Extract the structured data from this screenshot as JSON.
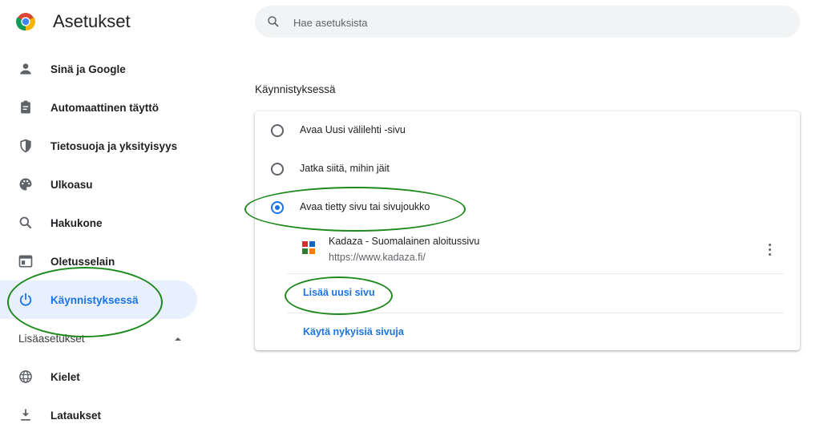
{
  "header": {
    "title": "Asetukset",
    "search_placeholder": "Hae asetuksista"
  },
  "sidebar": {
    "items": [
      {
        "label": "Sinä ja Google",
        "icon": "person-icon"
      },
      {
        "label": "Automaattinen täyttö",
        "icon": "clipboard-icon"
      },
      {
        "label": "Tietosuoja ja yksityisyys",
        "icon": "shield-icon"
      },
      {
        "label": "Ulkoasu",
        "icon": "palette-icon"
      },
      {
        "label": "Hakukone",
        "icon": "search-icon"
      },
      {
        "label": "Oletusselain",
        "icon": "browser-window-icon"
      },
      {
        "label": "Käynnistyksessä",
        "icon": "power-icon",
        "active": true
      }
    ],
    "advanced_label": "Lisäasetukset",
    "advanced_items": [
      {
        "label": "Kielet",
        "icon": "globe-icon"
      },
      {
        "label": "Lataukset",
        "icon": "download-icon"
      }
    ]
  },
  "startup": {
    "section_title": "Käynnistyksessä",
    "options": [
      {
        "label": "Avaa Uusi välilehti -sivu",
        "checked": false
      },
      {
        "label": "Jatka siitä, mihin jäit",
        "checked": false
      },
      {
        "label": "Avaa tietty sivu tai sivujoukko",
        "checked": true
      }
    ],
    "pages": [
      {
        "name": "Kadaza - Suomalainen aloitussivu",
        "url": "https://www.kadaza.fi/"
      }
    ],
    "add_page_label": "Lisää uusi sivu",
    "use_current_label": "Käytä nykyisiä sivuja"
  },
  "colors": {
    "accent": "#1a73e8",
    "active_bg": "#e8f0fe",
    "annotation": "#1e8a1e"
  }
}
